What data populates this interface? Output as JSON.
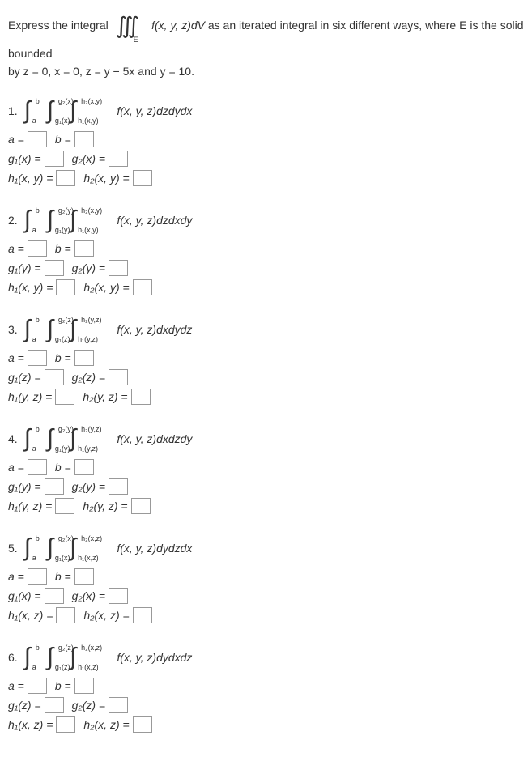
{
  "intro": {
    "prefix": "Express the integral",
    "triple_int": "∭",
    "sub_E": "E",
    "integrand_top": "f(x, y, z)dV",
    "suffix": "as an iterated integral in six different ways, where E is the solid bounded",
    "line2": "by z = 0, x = 0, z = y − 5x and y = 10."
  },
  "problems": [
    {
      "num": "1.",
      "int1": {
        "lower": "a",
        "upper": "b"
      },
      "int2": {
        "lower": "g₁(x)",
        "upper": "g₂(x)"
      },
      "int3": {
        "lower": "h₁(x,y)",
        "upper": "h₂(x,y)"
      },
      "integrand": "f(x, y, z)dzdydx",
      "lines": [
        {
          "l1": "a =",
          "l2": "b ="
        },
        {
          "l1": "g₁(x) =",
          "l2": "g₂(x) ="
        },
        {
          "l1": "h₁(x, y) =",
          "l2": "h₂(x, y) ="
        }
      ]
    },
    {
      "num": "2.",
      "int1": {
        "lower": "a",
        "upper": "b"
      },
      "int2": {
        "lower": "g₁(y)",
        "upper": "g₂(y)"
      },
      "int3": {
        "lower": "h₁(x,y)",
        "upper": "h₂(x,y)"
      },
      "integrand": "f(x, y, z)dzdxdy",
      "lines": [
        {
          "l1": "a =",
          "l2": "b ="
        },
        {
          "l1": "g₁(y) =",
          "l2": "g₂(y) ="
        },
        {
          "l1": "h₁(x, y) =",
          "l2": "h₂(x, y) ="
        }
      ]
    },
    {
      "num": "3.",
      "int1": {
        "lower": "a",
        "upper": "b"
      },
      "int2": {
        "lower": "g₁(z)",
        "upper": "g₂(z)"
      },
      "int3": {
        "lower": "h₁(y,z)",
        "upper": "h₂(y,z)"
      },
      "integrand": "f(x, y, z)dxdydz",
      "lines": [
        {
          "l1": "a =",
          "l2": "b ="
        },
        {
          "l1": "g₁(z) =",
          "l2": "g₂(z) ="
        },
        {
          "l1": "h₁(y, z) =",
          "l2": "h₂(y, z) ="
        }
      ]
    },
    {
      "num": "4.",
      "int1": {
        "lower": "a",
        "upper": "b"
      },
      "int2": {
        "lower": "g₁(y)",
        "upper": "g₂(y)"
      },
      "int3": {
        "lower": "h₁(y,z)",
        "upper": "h₂(y,z)"
      },
      "integrand": "f(x, y, z)dxdzdy",
      "lines": [
        {
          "l1": "a =",
          "l2": "b ="
        },
        {
          "l1": "g₁(y) =",
          "l2": "g₂(y) ="
        },
        {
          "l1": "h₁(y, z) =",
          "l2": "h₂(y, z) ="
        }
      ]
    },
    {
      "num": "5.",
      "int1": {
        "lower": "a",
        "upper": "b"
      },
      "int2": {
        "lower": "g₁(x)",
        "upper": "g₂(x)"
      },
      "int3": {
        "lower": "h₁(x,z)",
        "upper": "h₂(x,z)"
      },
      "integrand": "f(x, y, z)dydzdx",
      "lines": [
        {
          "l1": "a =",
          "l2": "b ="
        },
        {
          "l1": "g₁(x) =",
          "l2": "g₂(x) ="
        },
        {
          "l1": "h₁(x, z) =",
          "l2": "h₂(x, z) ="
        }
      ]
    },
    {
      "num": "6.",
      "int1": {
        "lower": "a",
        "upper": "b"
      },
      "int2": {
        "lower": "g₁(z)",
        "upper": "g₂(z)"
      },
      "int3": {
        "lower": "h₁(x,z)",
        "upper": "h₂(x,z)"
      },
      "integrand": "f(x, y, z)dydxdz",
      "lines": [
        {
          "l1": "a =",
          "l2": "b ="
        },
        {
          "l1": "g₁(z) =",
          "l2": "g₂(z) ="
        },
        {
          "l1": "h₁(x, z) =",
          "l2": "h₂(x, z) ="
        }
      ]
    }
  ]
}
